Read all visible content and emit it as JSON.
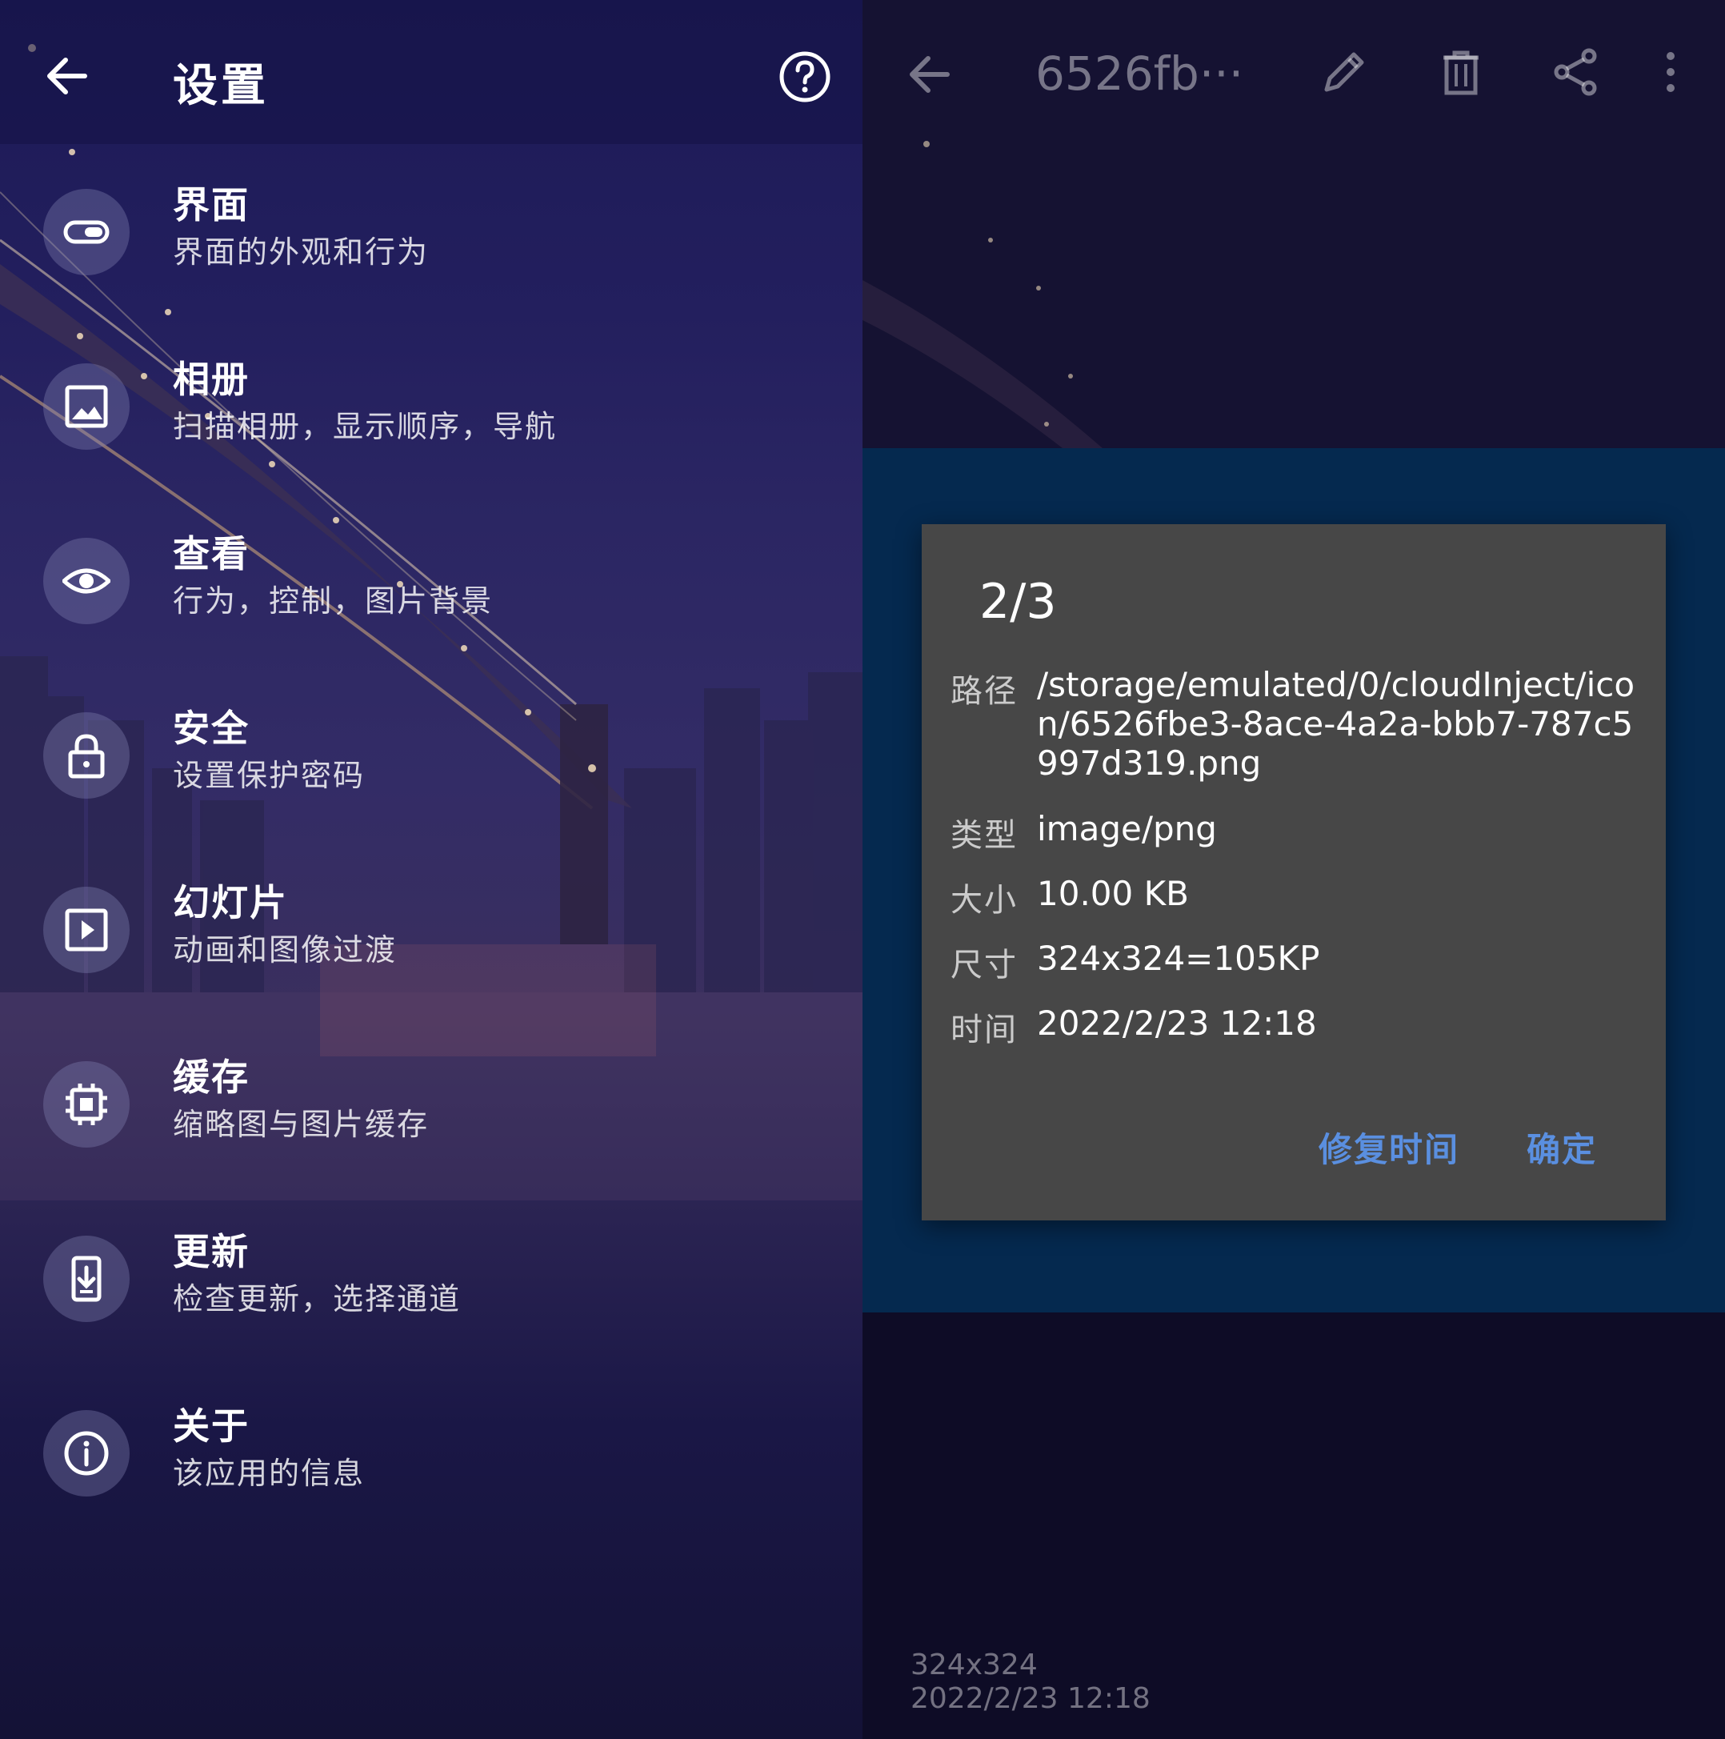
{
  "colors": {
    "left_bg": "#231f5e",
    "right_bg": "#0f0d28",
    "image_band": "#05294f",
    "dialog_bg": "#474747",
    "dialog_button": "#5a8fe0"
  },
  "settings": {
    "title": "设置",
    "back_icon": "arrow-left-icon",
    "help_icon": "help-circle-icon",
    "items": [
      {
        "icon": "toggle-icon",
        "title": "界面",
        "subtitle": "界面的外观和行为"
      },
      {
        "icon": "image-icon",
        "title": "相册",
        "subtitle": "扫描相册，显示顺序，导航"
      },
      {
        "icon": "eye-icon",
        "title": "查看",
        "subtitle": "行为，控制，图片背景"
      },
      {
        "icon": "lock-icon",
        "title": "安全",
        "subtitle": "设置保护密码"
      },
      {
        "icon": "play-icon",
        "title": "幻灯片",
        "subtitle": "动画和图像过渡"
      },
      {
        "icon": "chip-icon",
        "title": "缓存",
        "subtitle": "缩略图与图片缓存"
      },
      {
        "icon": "download-icon",
        "title": "更新",
        "subtitle": "检查更新，选择通道"
      },
      {
        "icon": "info-icon",
        "title": "关于",
        "subtitle": "该应用的信息"
      }
    ]
  },
  "viewer": {
    "title": "6526fb···",
    "toolbar_icons": [
      "arrow-left-icon",
      "pencil-icon",
      "trash-icon",
      "share-icon",
      "more-vertical-icon"
    ],
    "meta_dimensions": "324x324",
    "meta_date": "2022/2/23 12:18"
  },
  "dialog": {
    "title": "2/3",
    "rows": [
      {
        "label": "路径",
        "value": "/storage/emulated/0/cloudInject/icon/6526fbe3-8ace-4a2a-bbb7-787c5997d319.png"
      },
      {
        "label": "类型",
        "value": "image/png"
      },
      {
        "label": "大小",
        "value": "10.00 KB"
      },
      {
        "label": "尺寸",
        "value": "324x324=105KP"
      },
      {
        "label": "时间",
        "value": "2022/2/23 12:18"
      }
    ],
    "fix_time_button": "修复时间",
    "ok_button": "确定"
  }
}
